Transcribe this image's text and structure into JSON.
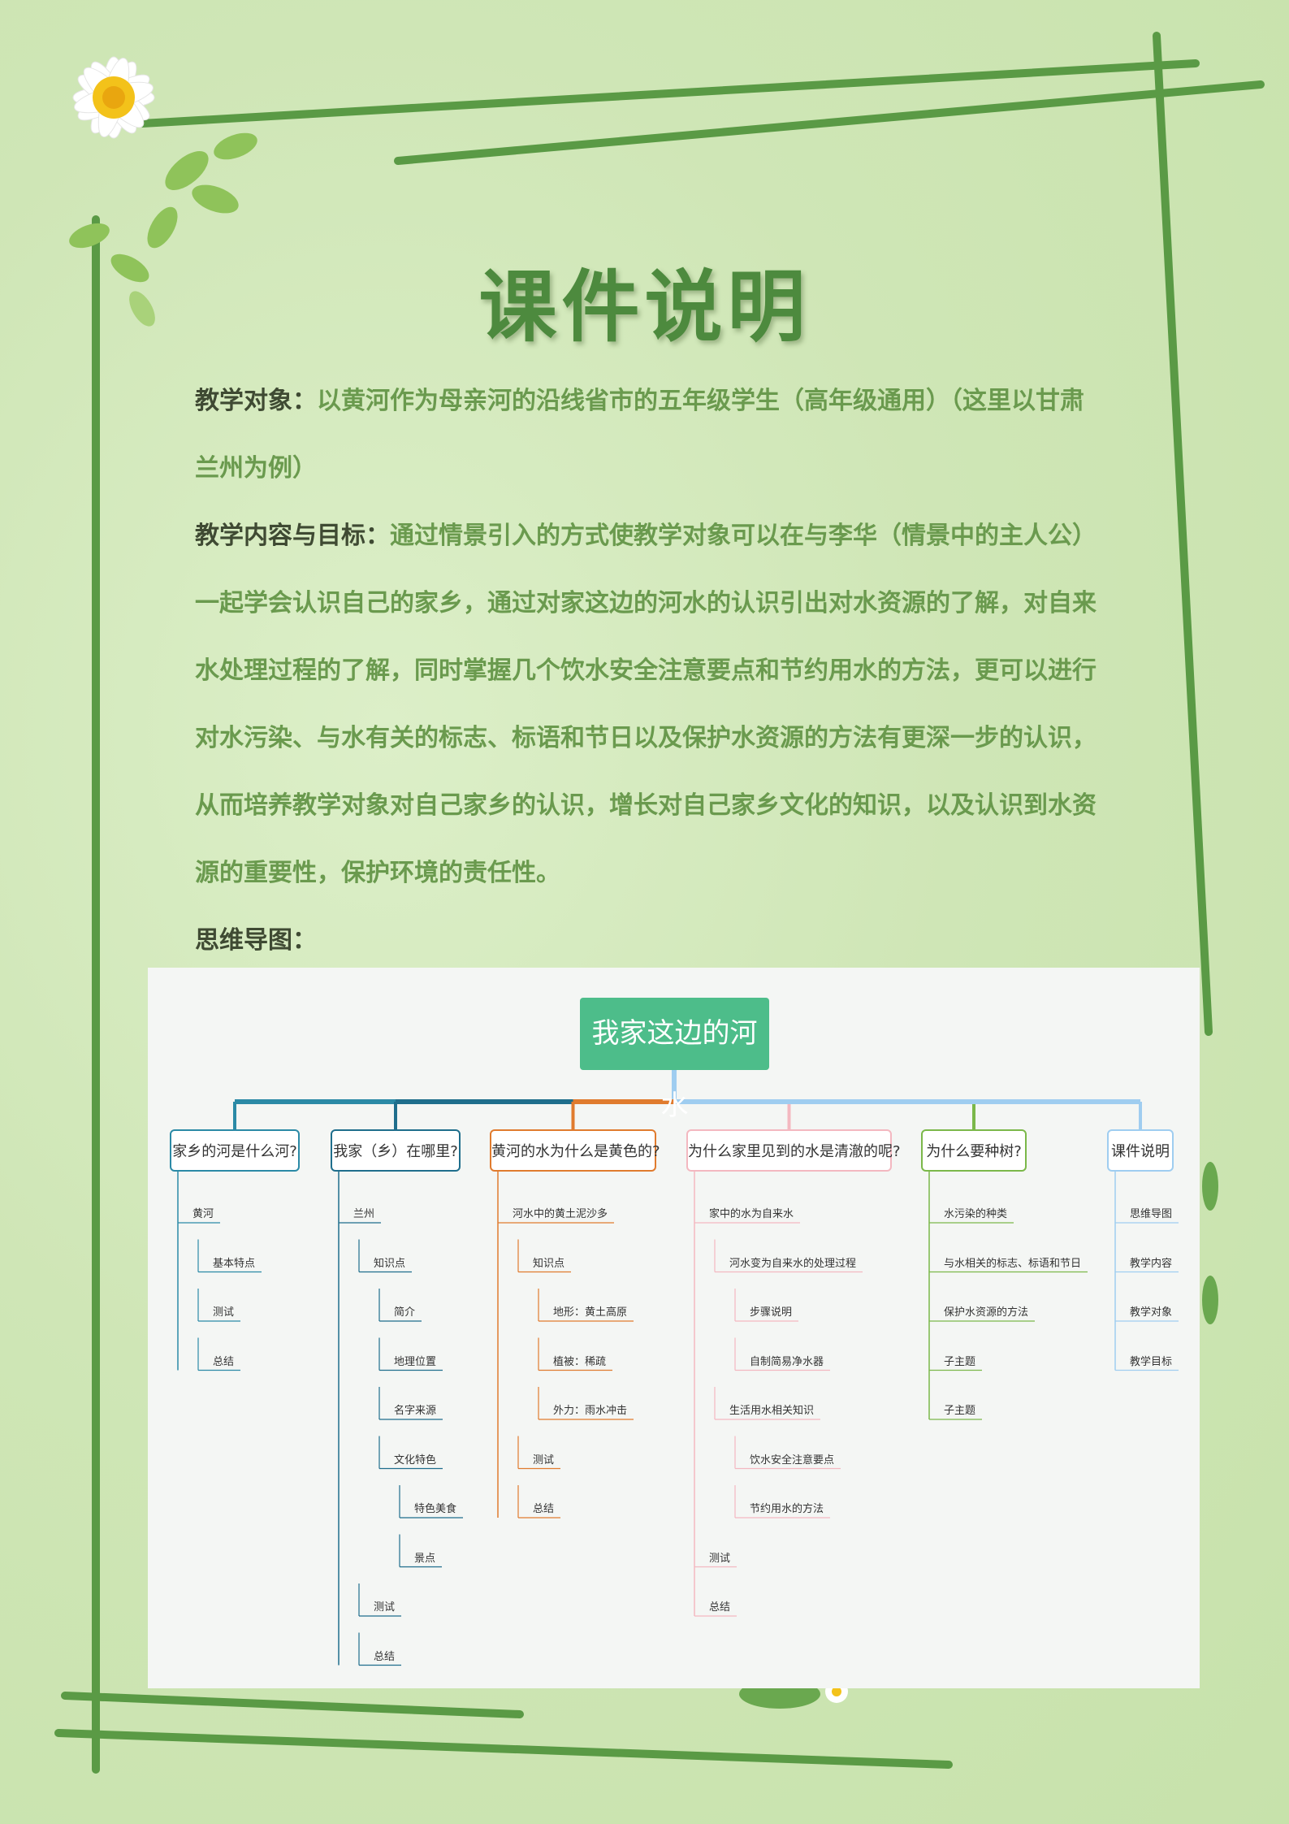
{
  "header": {
    "title": "课件说明"
  },
  "content": {
    "object_label": "教学对象：",
    "object_text": "以黄河作为母亲河的沿线省市的五年级学生（高年级通用）（这里以甘肃兰州为例）",
    "goal_label": "教学内容与目标：",
    "goal_text": "通过情景引入的方式使教学对象可以在与李华（情景中的主人公）一起学会认识自己的家乡，通过对家这边的河水的认识引出对水资源的了解，对自来水处理过程的了解，同时掌握几个饮水安全注意要点和节约用水的方法，更可以进行对水污染、与水有关的标志、标语和节日以及保护水资源的方法有更深一步的认识，从而培养教学对象对自己家乡的认识，增长对自己家乡文化的知识，以及认识到水资源的重要性，保护环境的责任性。",
    "mindmap_label": "思维导图："
  },
  "mindmap": {
    "root": "我家这边的河水",
    "branches": [
      {
        "label": "家乡的河是什么河?",
        "color": "#2b8aa6",
        "nodes": [
          "黄河",
          "基本特点",
          "测试",
          "总结"
        ]
      },
      {
        "label": "我家（乡）在哪里?",
        "color": "#1f6e8c",
        "nodes": [
          "兰州",
          "知识点",
          "简介",
          "地理位置",
          "名字来源",
          "文化特色",
          "特色美食",
          "景点",
          "测试",
          "总结"
        ]
      },
      {
        "label": "黄河的水为什么是黄色的?",
        "color": "#e07b2e",
        "nodes": [
          "河水中的黄土泥沙多",
          "知识点",
          "地形：黄土高原",
          "植被：稀疏",
          "外力：雨水冲击",
          "测试",
          "总结"
        ]
      },
      {
        "label": "为什么家里见到的水是清澈的呢?",
        "color": "#f3b8c0",
        "nodes": [
          "家中的水为自来水",
          "河水变为自来水的处理过程",
          "步骤说明",
          "自制简易净水器",
          "生活用水相关知识",
          "饮水安全注意要点",
          "节约用水的方法",
          "测试",
          "总结"
        ]
      },
      {
        "label": "为什么要种树?",
        "color": "#7bb84a",
        "nodes": [
          "水污染的种类",
          "与水相关的标志、标语和节日",
          "保护水资源的方法",
          "子主题",
          "子主题"
        ]
      },
      {
        "label": "课件说明",
        "color": "#9fcdf0",
        "nodes": [
          "思维导图",
          "教学内容",
          "教学对象",
          "教学目标"
        ]
      }
    ]
  },
  "colors": {
    "accent": "#4d8a3e",
    "frame": "#5a9a45",
    "root_box": "#4dbd8a"
  }
}
